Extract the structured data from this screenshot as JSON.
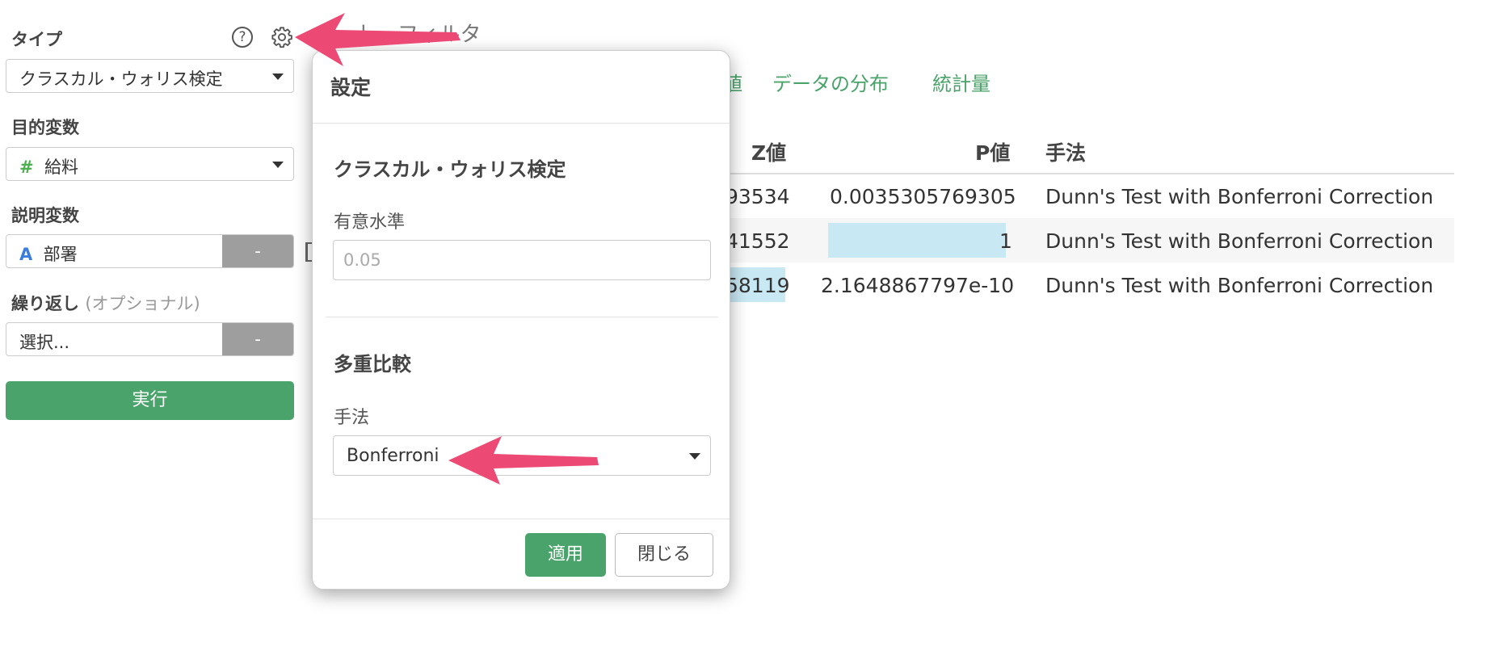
{
  "sidebar": {
    "type_label": "タイプ",
    "type_value": "クラスカル・ウォリス検定",
    "target_label": "目的変数",
    "target_icon": "#",
    "target_value": "給料",
    "explanatory_label": "説明変数",
    "explanatory_icon": "A",
    "explanatory_value": "部署",
    "explanatory_clear": "-",
    "repeat_label": "繰り返し",
    "repeat_optional": "(オプショナル)",
    "repeat_value": "選択...",
    "repeat_clear": "-",
    "run_label": "実行",
    "help_glyph": "?"
  },
  "background": {
    "filter_label": "ト・フィルタ",
    "tabs": [
      "値",
      "データの分布",
      "統計量"
    ],
    "table": {
      "headers": [
        "Z値",
        "P値",
        "手法"
      ],
      "rows": [
        {
          "z": "93534",
          "p": "0.0035305769305",
          "method": "Dunn's Test with Bonferroni Correction"
        },
        {
          "z": "41552",
          "p": "1",
          "method": "Dunn's Test with Bonferroni Correction"
        },
        {
          "z": "58119",
          "p": "2.1648867797e-10",
          "method": "Dunn's Test with Bonferroni Correction"
        }
      ],
      "p_bar_fill": [
        0.0,
        1.0,
        0.0
      ]
    }
  },
  "modal": {
    "title": "設定",
    "section1": "クラスカル・ウォリス検定",
    "significance_label": "有意水準",
    "significance_placeholder": "0.05",
    "section2": "多重比較",
    "method_label": "手法",
    "method_value": "Bonferroni",
    "apply_label": "適用",
    "close_label": "閉じる"
  },
  "colors": {
    "accent_green": "#4aa36a",
    "arrow_pink": "#ec4a75",
    "bar_blue": "#c8e8f3"
  }
}
